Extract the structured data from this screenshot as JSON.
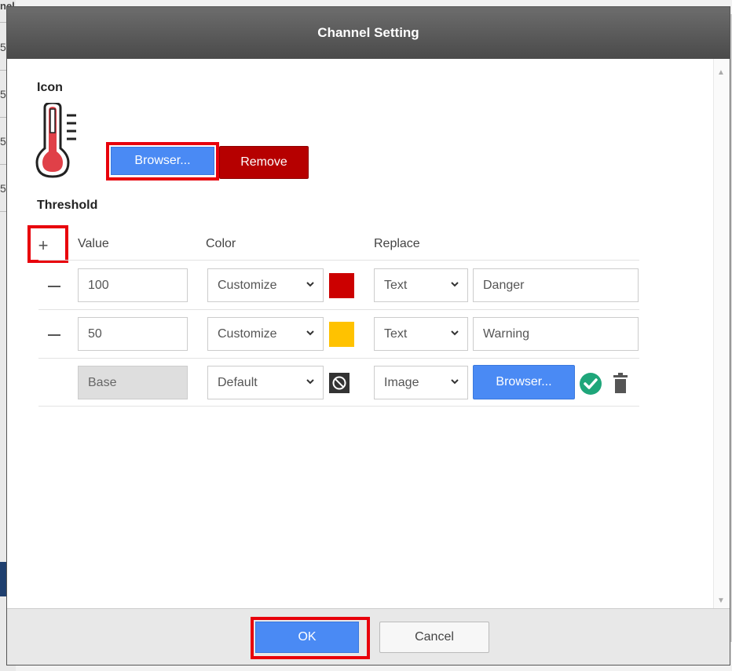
{
  "background": {
    "left_header": "nel",
    "row_digits": [
      "5",
      "5",
      "5",
      "5"
    ]
  },
  "dialog": {
    "title": "Channel Setting"
  },
  "icon_section": {
    "label": "Icon",
    "icon_name": "thermometer-icon",
    "browse_label": "Browser...",
    "remove_label": "Remove"
  },
  "threshold": {
    "label": "Threshold",
    "add_symbol": "+",
    "headers": {
      "value": "Value",
      "color": "Color",
      "replace": "Replace"
    },
    "rows": [
      {
        "value": "100",
        "color_mode": "Customize",
        "color": "#cc0000",
        "replace_type": "Text",
        "replace_value": "Danger"
      },
      {
        "value": "50",
        "color_mode": "Customize",
        "color": "#ffc200",
        "replace_type": "Text",
        "replace_value": "Warning"
      },
      {
        "value": "Base",
        "color_mode": "Default",
        "replace_type": "Image",
        "browse_label": "Browser..."
      }
    ]
  },
  "footer": {
    "ok_label": "OK",
    "cancel_label": "Cancel"
  },
  "colors": {
    "accent_blue": "#4a8af4",
    "danger_red": "#b60000",
    "highlight_red": "#e8000b",
    "success_green": "#1fa67a"
  }
}
